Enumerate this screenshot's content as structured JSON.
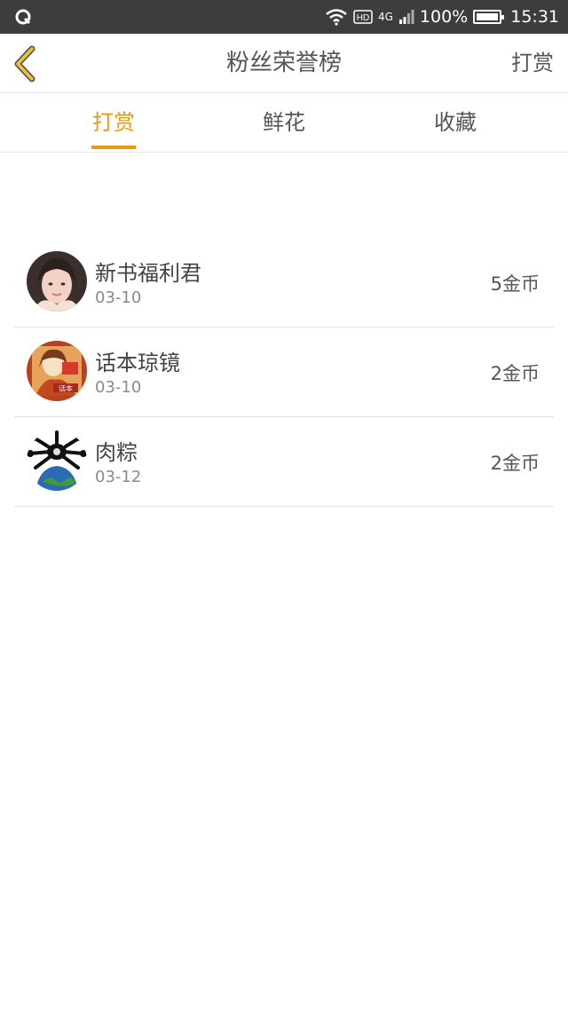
{
  "status_bar": {
    "network": "4G",
    "battery": "100%",
    "time": "15:31"
  },
  "header": {
    "title": "粉丝荣誉榜",
    "action_label": "打赏"
  },
  "tabs": [
    {
      "label": "打赏",
      "active": true
    },
    {
      "label": "鲜花",
      "active": false
    },
    {
      "label": "收藏",
      "active": false
    }
  ],
  "list": [
    {
      "name": "新书福利君",
      "date": "03-10",
      "amount": "5金币"
    },
    {
      "name": "话本琼镜",
      "date": "03-10",
      "amount": "2金币"
    },
    {
      "name": "肉粽",
      "date": "03-12",
      "amount": "2金币"
    }
  ],
  "colors": {
    "accent": "#e89a12",
    "status_bar": "#3d3d3d",
    "divider": "#e3e3e3"
  }
}
